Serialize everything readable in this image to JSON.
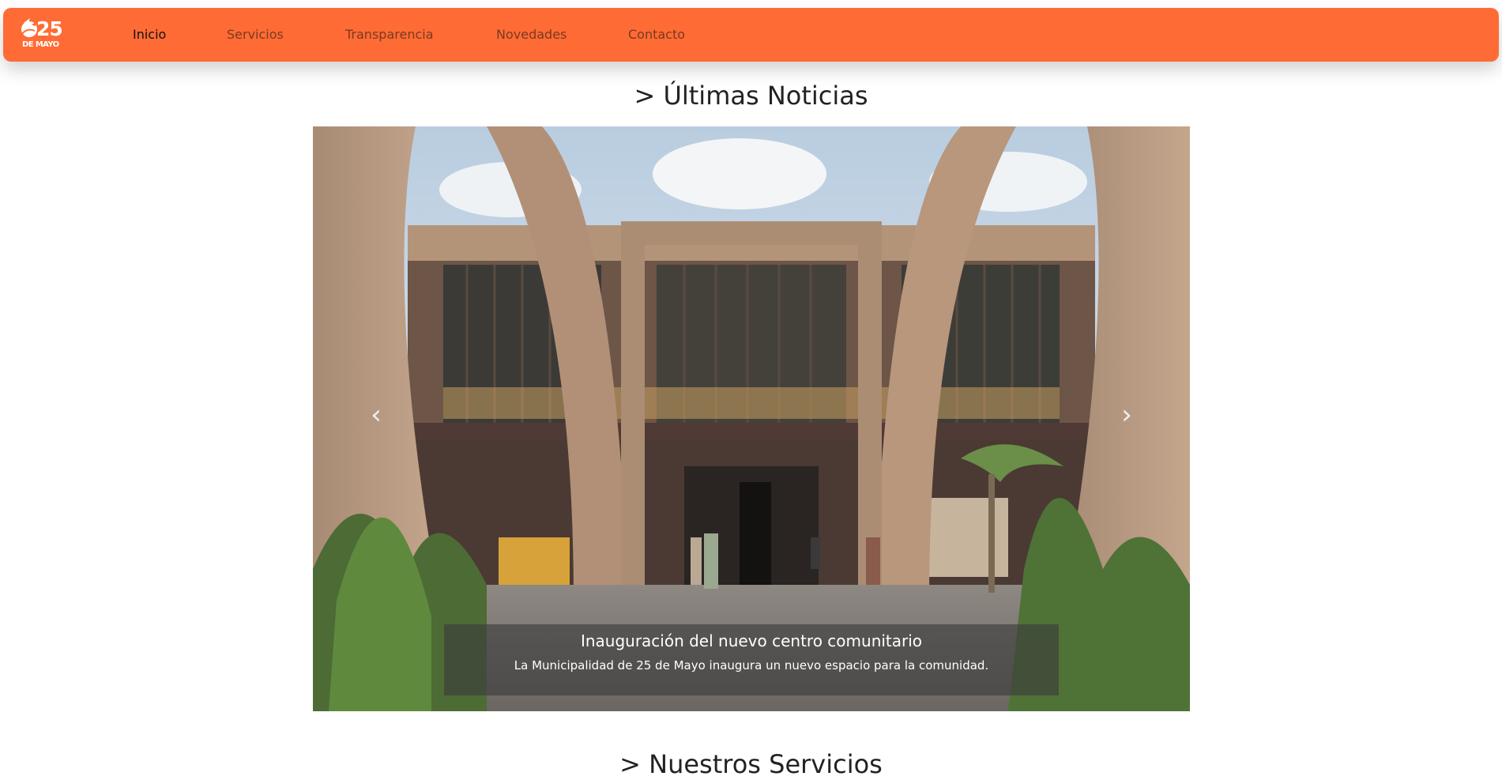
{
  "brand": {
    "logo_number": "25",
    "logo_subtitle": "DE MAYO",
    "accent_color": "#ff6b35"
  },
  "nav": {
    "items": [
      {
        "label": "Inicio",
        "active": true
      },
      {
        "label": "Servicios",
        "active": false
      },
      {
        "label": "Transparencia",
        "active": false
      },
      {
        "label": "Novedades",
        "active": false
      },
      {
        "label": "Contacto",
        "active": false
      }
    ]
  },
  "news": {
    "section_title": "> Últimas Noticias",
    "slide": {
      "image_icon": "building-photo",
      "title": "Inauguración del nuevo centro comunitario",
      "text": "La Municipalidad de 25 de Mayo inaugura un nuevo espacio para la comunidad."
    },
    "prev_icon": "chevron-left-icon",
    "next_icon": "chevron-right-icon"
  },
  "services": {
    "section_title": "> Nuestros Servicios"
  }
}
